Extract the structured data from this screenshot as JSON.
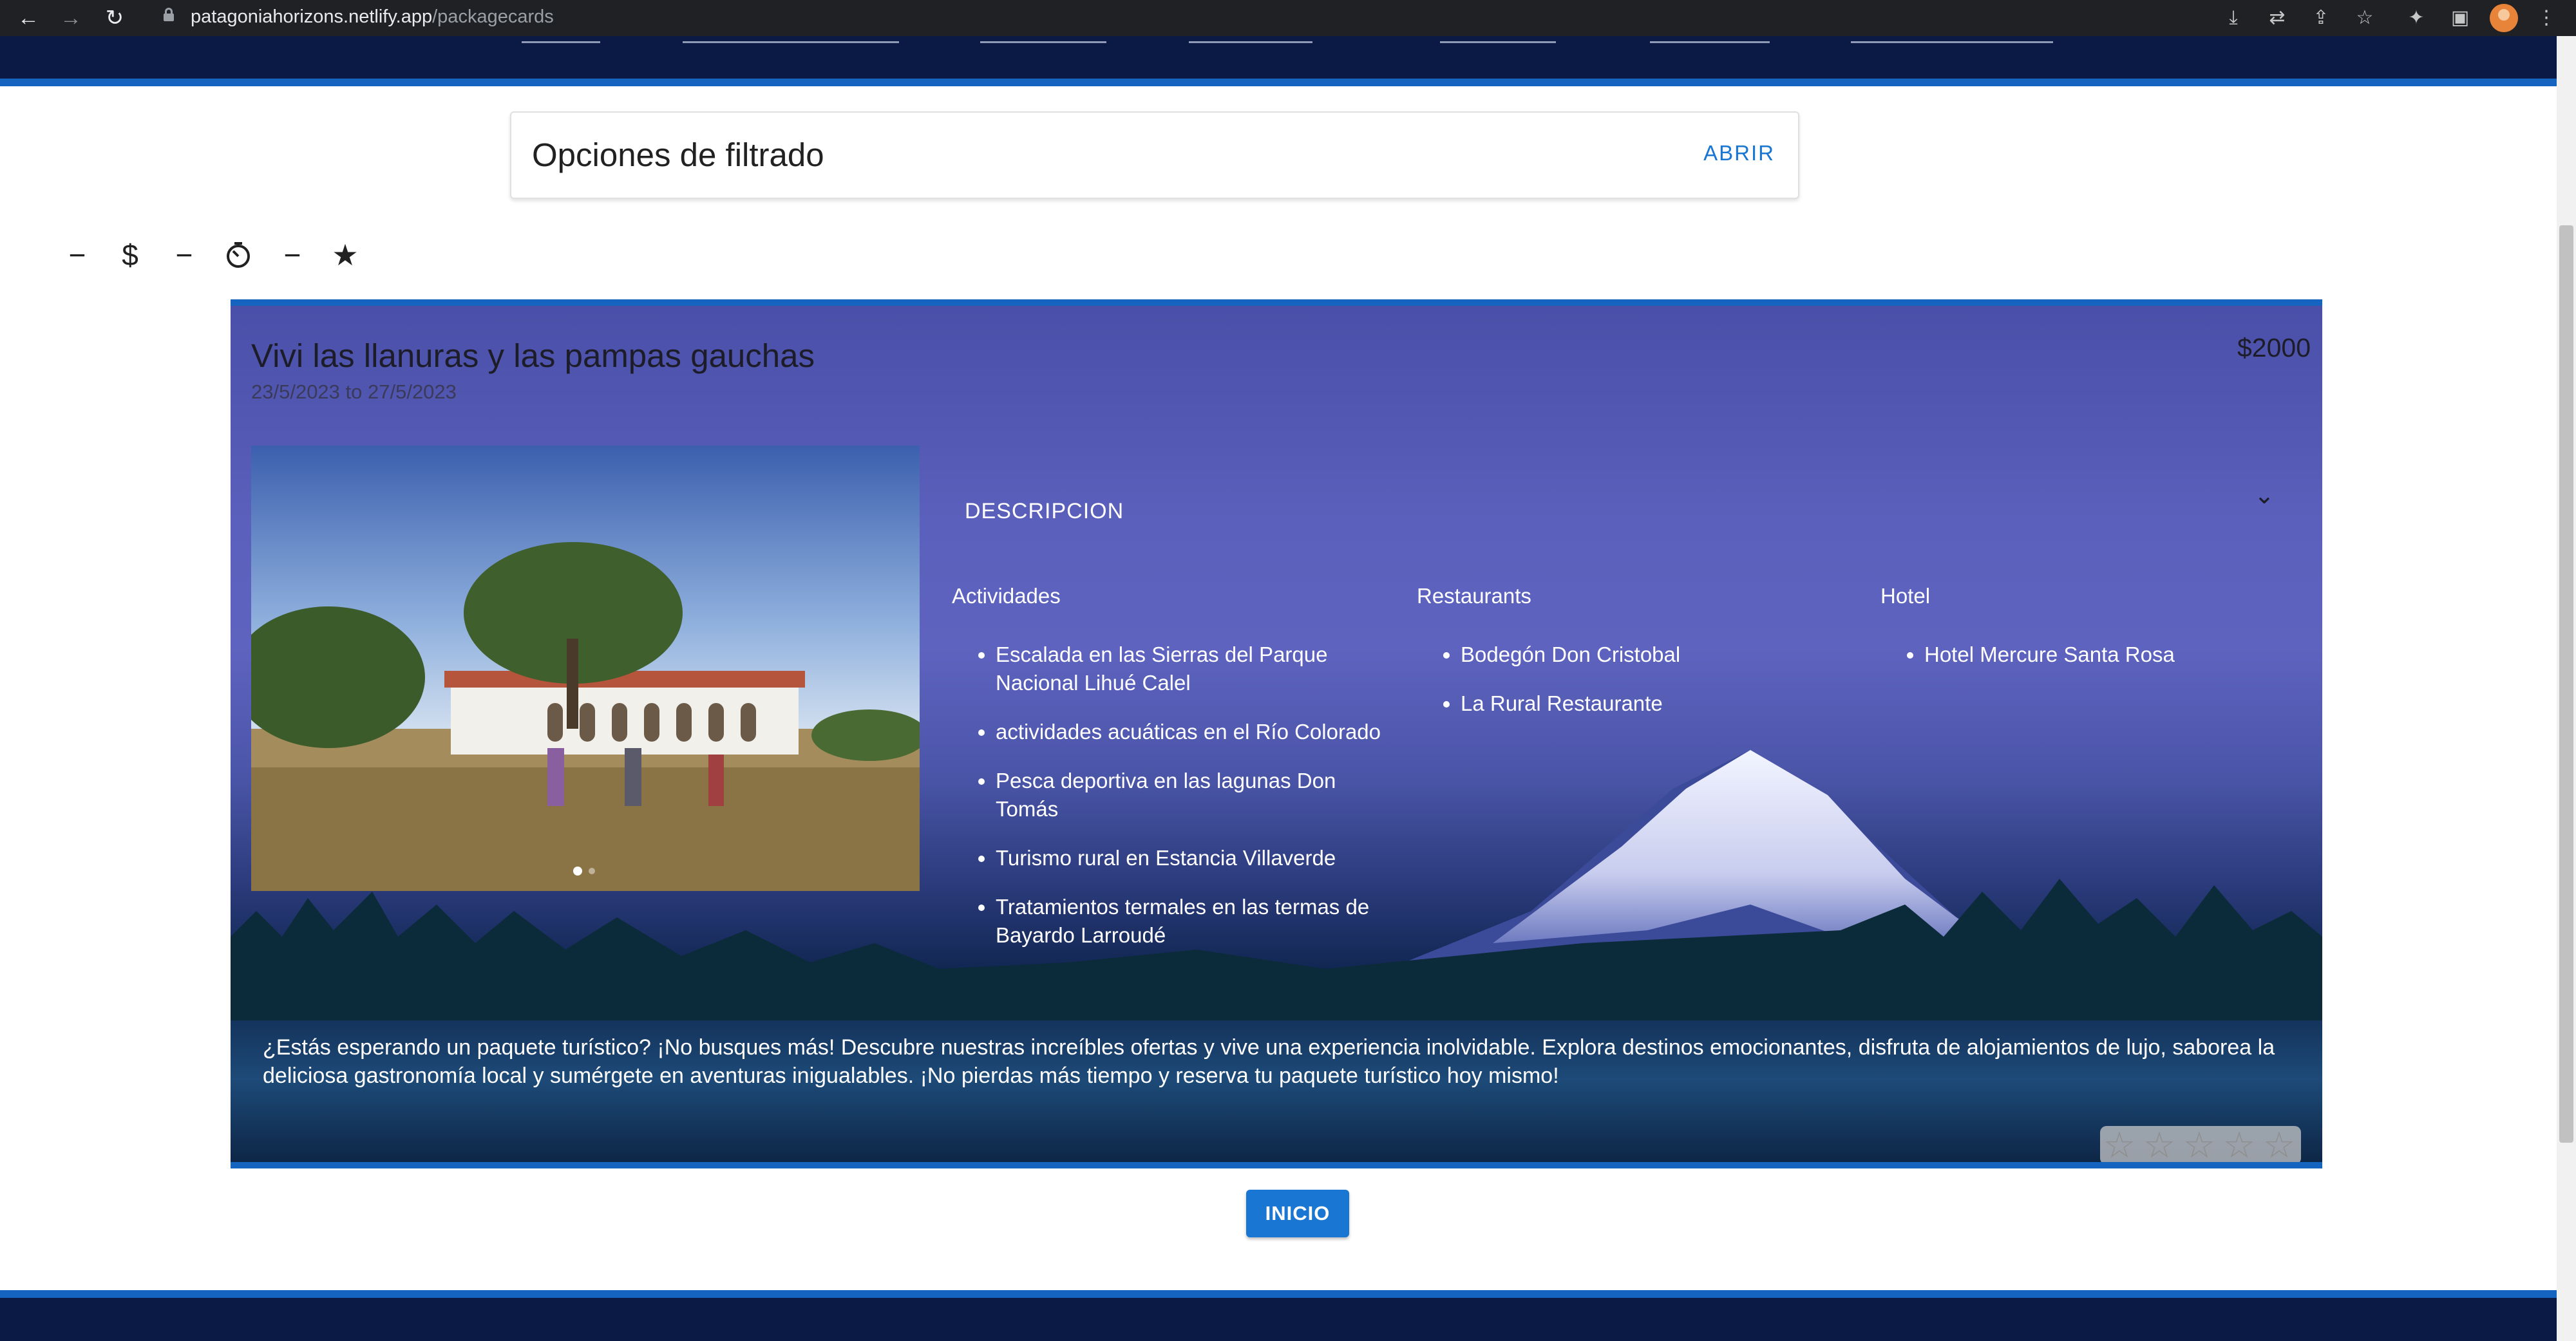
{
  "browser": {
    "url_host": "patagoniahorizons.netlify.app",
    "url_path": "/packagecards",
    "icons": [
      "back-icon",
      "forward-icon",
      "reload-icon",
      "lock-icon",
      "install-icon",
      "translate-icon",
      "share-icon",
      "bookmark-star-icon",
      "extensions-icon",
      "sidebar-icon",
      "profile-avatar",
      "menu-kebab-icon"
    ]
  },
  "filter": {
    "title": "Opciones de filtrado",
    "open_label": "ABRIR"
  },
  "sort_icons": [
    "minus-icon",
    "dollar-icon",
    "minus-icon",
    "timer-icon",
    "minus-icon",
    "star-icon"
  ],
  "card": {
    "title": "Vivi las llanuras y las pampas gauchas",
    "dates": "23/5/2023 to 27/5/2023",
    "price": "$2000",
    "description_label": "DESCRIPCION",
    "activities_title": "Actividades",
    "activities": [
      "Escalada en las Sierras del Parque Nacional Lihué Calel",
      "actividades acuáticas en el Río Colorado",
      "Pesca deportiva en las lagunas Don Tomás",
      "Turismo rural en Estancia Villaverde",
      "Tratamientos termales en las termas de Bayardo Larroudé"
    ],
    "restaurants_title": "Restaurants",
    "restaurants": [
      "Bodegón Don Cristobal",
      "La Rural Restaurante"
    ],
    "hotel_title": "Hotel",
    "hotels": [
      "Hotel Mercure Santa Rosa"
    ],
    "promo": "¿Estás esperando un paquete turístico? ¡No busques más! Descubre nuestras increíbles ofertas y vive una experiencia inolvidable. Explora destinos emocionantes, disfruta de alojamientos de lujo, saborea la deliciosa gastronomía local y sumérgete en aventuras inigualables. ¡No pierdas más tiempo y reserva tu paquete turístico hoy mismo!",
    "rating": 0,
    "rating_max": 5
  },
  "home_button": "INICIO"
}
